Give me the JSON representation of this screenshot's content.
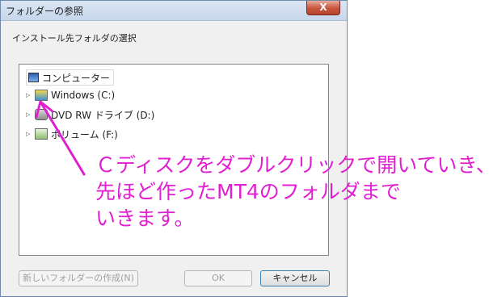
{
  "dialog": {
    "title": "フォルダーの参照",
    "close_label": "X",
    "prompt": "インストール先フォルダの選択"
  },
  "tree": {
    "root": {
      "label": "コンピューター",
      "icon": "computer-icon"
    },
    "items": [
      {
        "label": "Windows (C:)",
        "icon": "windows-drive-icon"
      },
      {
        "label": "DVD RW ドライブ (D:)",
        "icon": "dvd-drive-icon"
      },
      {
        "label": "ボリューム (F:)",
        "icon": "volume-drive-icon"
      }
    ]
  },
  "buttons": {
    "new_folder": "新しいフォルダーの作成(N)",
    "ok": "OK",
    "cancel": "キャンセル"
  },
  "annotation": {
    "line1": "Ｃディスクをダブルクリックで開いていき、",
    "line2": "先ほど作ったMT4のフォルダまで",
    "line3": "いきます。",
    "color": "#e020d0"
  }
}
